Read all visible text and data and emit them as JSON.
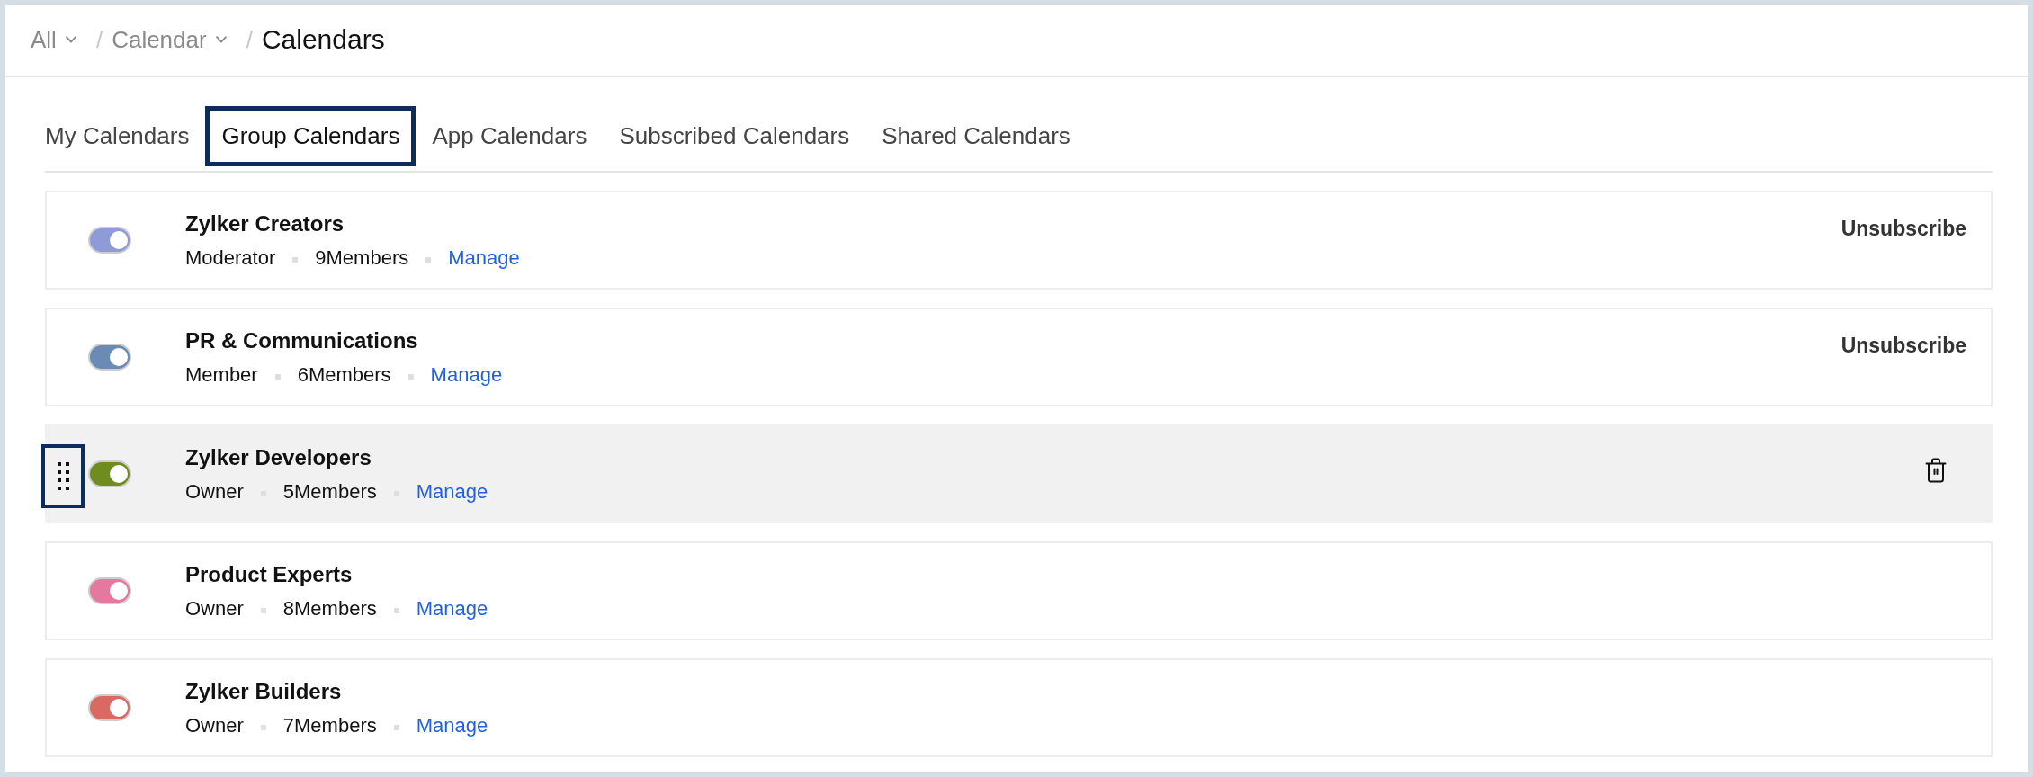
{
  "breadcrumb": [
    {
      "label": "All",
      "dropdown": true,
      "current": false,
      "separator": "/"
    },
    {
      "label": "Calendar",
      "dropdown": true,
      "current": false,
      "separator": "/"
    },
    {
      "label": "Calendars",
      "dropdown": false,
      "current": true
    }
  ],
  "tabs": [
    {
      "label": "My Calendars",
      "selected": false
    },
    {
      "label": "Group Calendars",
      "selected": true
    },
    {
      "label": "App Calendars",
      "selected": false
    },
    {
      "label": "Subscribed Calendars",
      "selected": false
    },
    {
      "label": "Shared Calendars",
      "selected": false
    }
  ],
  "rows": [
    {
      "name": "Zylker Creators",
      "role": "Moderator",
      "members": "9Members",
      "link": "Manage",
      "on": true,
      "color": "#8e9bd7",
      "highlighted": false,
      "drag_handle": false,
      "action": {
        "kind": "text",
        "label": "Unsubscribe"
      }
    },
    {
      "name": "PR & Communications",
      "role": "Member",
      "members": "6Members",
      "link": "Manage",
      "on": true,
      "color": "#6a8bb3",
      "highlighted": false,
      "drag_handle": false,
      "action": {
        "kind": "text",
        "label": "Unsubscribe"
      }
    },
    {
      "name": "Zylker Developers",
      "role": "Owner",
      "members": "5Members",
      "link": "Manage",
      "on": true,
      "color": "#6f8c1f",
      "highlighted": true,
      "drag_handle": true,
      "action": {
        "kind": "trash"
      }
    },
    {
      "name": "Product Experts",
      "role": "Owner",
      "members": "8Members",
      "link": "Manage",
      "on": true,
      "color": "#e4789e",
      "highlighted": false,
      "drag_handle": false
    },
    {
      "name": "Zylker Builders",
      "role": "Owner",
      "members": "7Members",
      "link": "Manage",
      "on": true,
      "color": "#d96a63",
      "highlighted": false,
      "drag_handle": false
    }
  ]
}
